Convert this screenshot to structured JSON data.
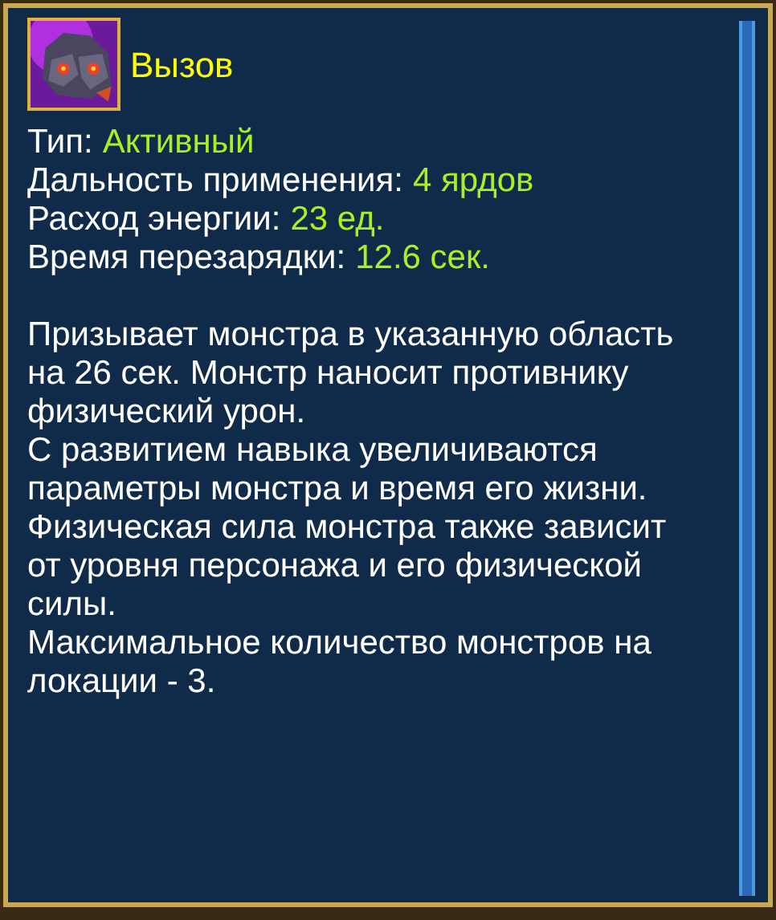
{
  "title": "Вызов",
  "stats": [
    {
      "label": "Тип:",
      "value": "Активный"
    },
    {
      "label": "Дальность применения:",
      "value": "4 ярдов"
    },
    {
      "label": "Расход энергии:",
      "value": "23 ед."
    },
    {
      "label": "Время перезарядки:",
      "value": "12.6 сек."
    }
  ],
  "description": [
    "Призывает монстра в указанную область на 26 сек. Монстр наносит противнику физический урон.",
    "С развитием навыка увеличиваются параметры монстра и время его жизни.",
    "Физическая сила монстра также зависит от уровня персонажа и его физической силы.",
    "Максимальное количество монстров на локации - 3."
  ]
}
